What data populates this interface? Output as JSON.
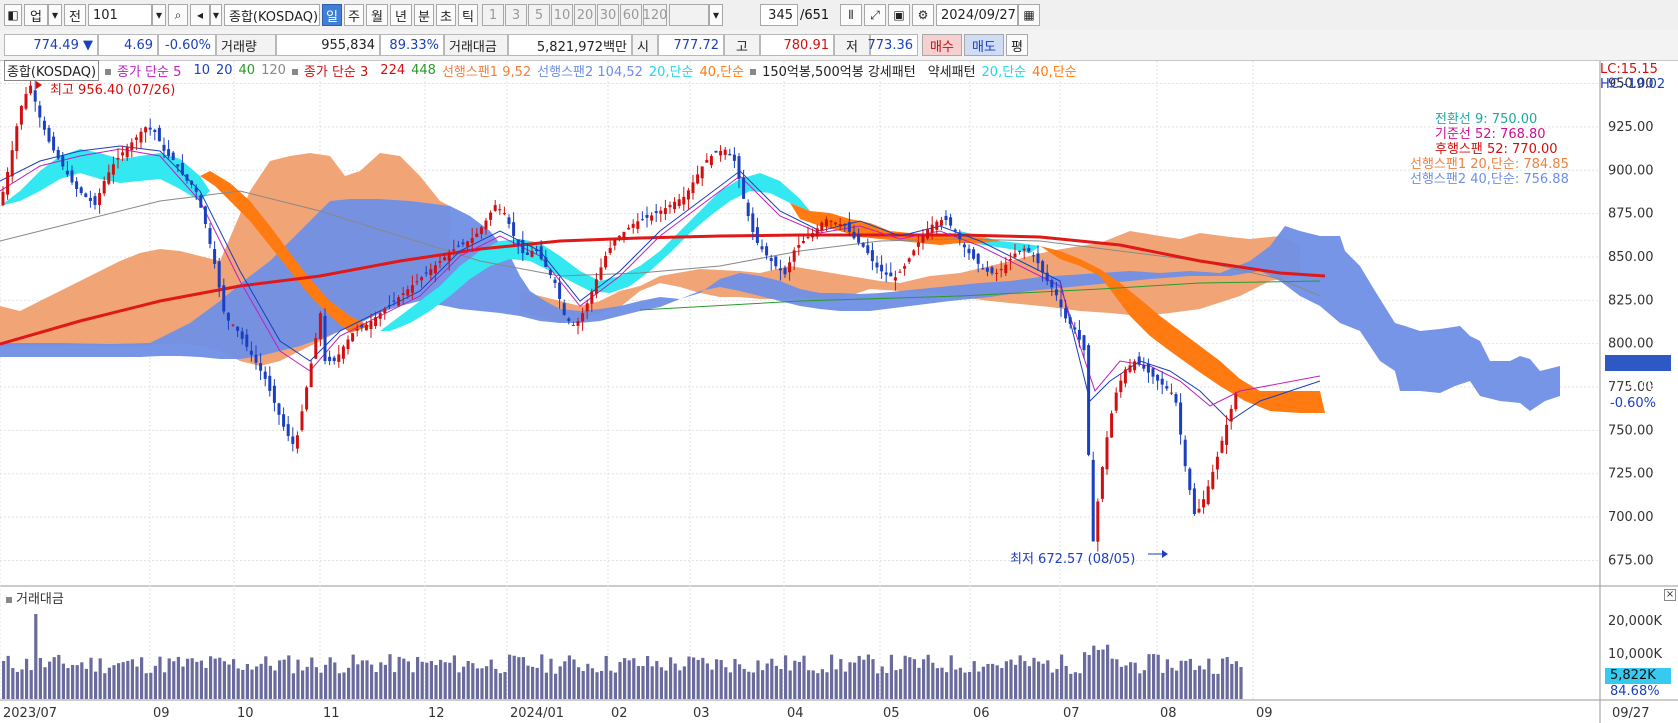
{
  "toolbar": {
    "type_select": "업",
    "prev_label": "전",
    "code_value": "101",
    "market_label": "종합(KOSDAQ)",
    "period_buttons": [
      "일",
      "주",
      "월",
      "년",
      "분",
      "초",
      "틱"
    ],
    "interval_buttons": [
      "1",
      "3",
      "5",
      "10",
      "20",
      "30",
      "60",
      "120"
    ],
    "count_value": "345",
    "count_total": "/651",
    "date_value": "2024/09/27"
  },
  "quote": {
    "price": "774.49",
    "change_arrow": "▼",
    "change": "4.69",
    "change_pct": "-0.60%",
    "volume_label": "거래량",
    "volume": "955,834",
    "volume_pct": "89.33%",
    "amount_label": "거래대금",
    "amount": "5,821,972백만",
    "open_label": "시",
    "open": "777.72",
    "high_label": "고",
    "high": "780.91",
    "low_label": "저",
    "low": "773.36",
    "buy_label": "매수",
    "sell_label": "매도",
    "eval_label": "평"
  },
  "legend": {
    "title": "종합(KOSDAQ)",
    "ma_close": "종가 단순 5",
    "ma_periods": [
      "10",
      "20",
      "40",
      "120"
    ],
    "ma_close2": "종가 단순 3",
    "ma2_periods": [
      "224",
      "448"
    ],
    "span1": "선행스팬1 9,52",
    "span2": "선행스팬2 104,52",
    "s20": "20,단순",
    "s40": "40,단순",
    "pattern": "150억봉,500억봉 강세패턴",
    "weak": "약세패턴",
    "s20b": "20,단순",
    "s40b": "40,단순"
  },
  "chart_info": {
    "lc": "LC:15.15",
    "hc": "HC:-19.02",
    "high_note": "최고 956.40 (07/26)",
    "low_note": "최저 672.57 (08/05)",
    "ichimoku_labels": [
      "전환선 9: 750.00",
      "기준선 52: 768.80",
      "후행스팬 52: 770.00",
      "선행스팬1 20,단순: 784.85",
      "선행스팬2 40,단순: 756.88"
    ],
    "current_price_tag": "774.49",
    "current_pct_tag": "-0.60%",
    "volume_title": "거래대금",
    "volume_tag": "5,822K",
    "volume_pct_tag": "84.68%"
  },
  "colors": {
    "up": "#d01010",
    "down": "#1a3fbf",
    "cloud_orange": "#f0a070",
    "cloud_blue": "#6f8fe6",
    "cyan_band": "#33e8f0",
    "orange_band": "#ff7a10",
    "ma_red": "#e01818",
    "volume_bar": "#6a6a9c"
  },
  "chart_data": {
    "type": "candlestick",
    "title": "종합(KOSDAQ)",
    "y_ticks": [
      950,
      925,
      900,
      875,
      850,
      825,
      800,
      775,
      750,
      725,
      700,
      675
    ],
    "ylim": [
      662,
      963
    ],
    "x_ticks": [
      "2023/07",
      "09",
      "10",
      "11",
      "12",
      "2024/01",
      "02",
      "03",
      "04",
      "05",
      "06",
      "07",
      "08",
      "09"
    ],
    "last_x_label": "09/27",
    "volume_ticks": [
      "20,000K",
      "10,000K"
    ],
    "close_path": [
      [
        0,
        880
      ],
      [
        10,
        905
      ],
      [
        20,
        935
      ],
      [
        30,
        950
      ],
      [
        40,
        930
      ],
      [
        50,
        915
      ],
      [
        60,
        905
      ],
      [
        75,
        890
      ],
      [
        85,
        885
      ],
      [
        95,
        880
      ],
      [
        105,
        895
      ],
      [
        115,
        905
      ],
      [
        125,
        912
      ],
      [
        135,
        918
      ],
      [
        145,
        925
      ],
      [
        155,
        922
      ],
      [
        165,
        910
      ],
      [
        175,
        905
      ],
      [
        185,
        895
      ],
      [
        195,
        890
      ],
      [
        205,
        870
      ],
      [
        215,
        845
      ],
      [
        225,
        815
      ],
      [
        235,
        810
      ],
      [
        245,
        800
      ],
      [
        255,
        790
      ],
      [
        265,
        780
      ],
      [
        275,
        765
      ],
      [
        285,
        750
      ],
      [
        295,
        740
      ],
      [
        305,
        770
      ],
      [
        315,
        800
      ],
      [
        320,
        820
      ],
      [
        325,
        790
      ],
      [
        335,
        790
      ],
      [
        345,
        800
      ],
      [
        355,
        808
      ],
      [
        365,
        810
      ],
      [
        375,
        815
      ],
      [
        385,
        820
      ],
      [
        395,
        825
      ],
      [
        405,
        830
      ],
      [
        415,
        835
      ],
      [
        425,
        840
      ],
      [
        435,
        845
      ],
      [
        445,
        850
      ],
      [
        455,
        855
      ],
      [
        465,
        858
      ],
      [
        475,
        862
      ],
      [
        485,
        870
      ],
      [
        495,
        880
      ],
      [
        505,
        875
      ],
      [
        515,
        860
      ],
      [
        525,
        850
      ],
      [
        535,
        855
      ],
      [
        545,
        845
      ],
      [
        555,
        835
      ],
      [
        565,
        815
      ],
      [
        575,
        810
      ],
      [
        585,
        820
      ],
      [
        595,
        835
      ],
      [
        605,
        850
      ],
      [
        615,
        860
      ],
      [
        625,
        865
      ],
      [
        635,
        870
      ],
      [
        645,
        872
      ],
      [
        655,
        875
      ],
      [
        665,
        878
      ],
      [
        675,
        882
      ],
      [
        685,
        885
      ],
      [
        695,
        895
      ],
      [
        705,
        905
      ],
      [
        715,
        910
      ],
      [
        725,
        912
      ],
      [
        735,
        905
      ],
      [
        745,
        880
      ],
      [
        755,
        860
      ],
      [
        765,
        852
      ],
      [
        775,
        845
      ],
      [
        785,
        840
      ],
      [
        795,
        855
      ],
      [
        805,
        860
      ],
      [
        815,
        865
      ],
      [
        825,
        872
      ],
      [
        835,
        870
      ],
      [
        845,
        868
      ],
      [
        855,
        860
      ],
      [
        865,
        855
      ],
      [
        875,
        845
      ],
      [
        885,
        840
      ],
      [
        895,
        838
      ],
      [
        905,
        845
      ],
      [
        915,
        855
      ],
      [
        925,
        865
      ],
      [
        935,
        870
      ],
      [
        945,
        872
      ],
      [
        955,
        865
      ],
      [
        965,
        855
      ],
      [
        975,
        848
      ],
      [
        985,
        842
      ],
      [
        995,
        840
      ],
      [
        1005,
        845
      ],
      [
        1015,
        852
      ],
      [
        1025,
        855
      ],
      [
        1035,
        850
      ],
      [
        1045,
        838
      ],
      [
        1055,
        830
      ],
      [
        1065,
        815
      ],
      [
        1075,
        808
      ],
      [
        1085,
        795
      ],
      [
        1092,
        680
      ],
      [
        1098,
        710
      ],
      [
        1105,
        740
      ],
      [
        1115,
        770
      ],
      [
        1125,
        785
      ],
      [
        1135,
        790
      ],
      [
        1145,
        785
      ],
      [
        1155,
        780
      ],
      [
        1165,
        775
      ],
      [
        1175,
        770
      ],
      [
        1185,
        730
      ],
      [
        1195,
        700
      ],
      [
        1205,
        712
      ],
      [
        1215,
        730
      ],
      [
        1225,
        750
      ],
      [
        1235,
        770
      ],
      [
        1240,
        776
      ]
    ]
  }
}
